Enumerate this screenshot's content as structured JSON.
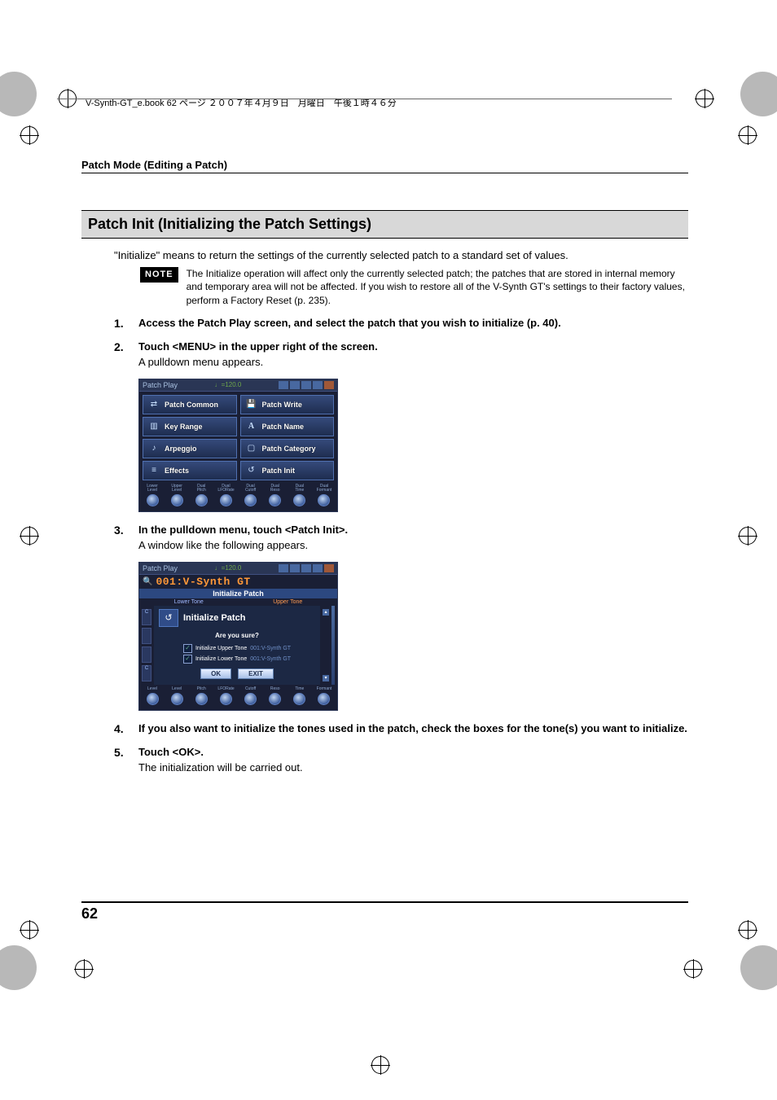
{
  "cropmarks": true,
  "header_line": "V-Synth-GT_e.book  62 ページ  ２００７年４月９日　月曜日　午後１時４６分",
  "section_header": "Patch Mode (Editing a Patch)",
  "title": "Patch Init (Initializing the Patch Settings)",
  "intro": "\"Initialize\" means to return the settings of the currently selected patch to a standard set of values.",
  "note_badge": "NOTE",
  "note_text": "The Initialize operation will affect only the currently selected patch; the patches that are stored in internal memory and temporary area will not be affected. If you wish to restore all of the V-Synth GT's settings to their factory values, perform a Factory Reset (p. 235).",
  "steps": {
    "s1": {
      "num": "1.",
      "title": "Access the Patch Play screen, and select the patch that you wish to initialize (p. 40)."
    },
    "s2": {
      "num": "2.",
      "title": "Touch <MENU> in the upper right of the screen.",
      "sub": "A pulldown menu appears."
    },
    "s3": {
      "num": "3.",
      "title": "In the pulldown menu, touch <Patch Init>.",
      "sub": "A window like the following appears."
    },
    "s4": {
      "num": "4.",
      "title": "If you also want to initialize the tones used in the patch, check the boxes for the tone(s) you want to initialize."
    },
    "s5": {
      "num": "5.",
      "title": "Touch <OK>.",
      "sub": "The initialization will be carried out."
    }
  },
  "screenshot1": {
    "screen_title": "Patch Play",
    "tempo": "♩=120.0",
    "menu_left": [
      "Patch Common",
      "Key Range",
      "Arpeggio",
      "Effects"
    ],
    "menu_right": [
      "Patch Write",
      "Patch Name",
      "Patch Category",
      "Patch Init"
    ],
    "knobs": [
      "Lower Level",
      "Upper Level",
      "Dual Pitch",
      "Dual LFORate",
      "Dual Cutoff",
      "Dual Reso",
      "Dual Time",
      "Dual Formant"
    ]
  },
  "screenshot2": {
    "screen_title": "Patch Play",
    "tempo": "♩=120.0",
    "patch_name": "001:V-Synth GT",
    "dialog_bar": "Initialize Patch",
    "lower_tab": "Lower Tone",
    "upper_tab": "Upper Tone",
    "dialog_header": "Initialize Patch",
    "are_you_sure": "Are you sure?",
    "check1_label": "Initialize Upper Tone",
    "check1_val": "001:V-Synth GT",
    "check2_label": "Initialize Lower Tone",
    "check2_val": "001:V-Synth GT",
    "ok": "OK",
    "exit": "EXIT",
    "knobs": [
      "Level",
      "Level",
      "Pitch",
      "LFORate",
      "Cutoff",
      "Reso",
      "Time",
      "Formant"
    ]
  },
  "page_number": "62"
}
